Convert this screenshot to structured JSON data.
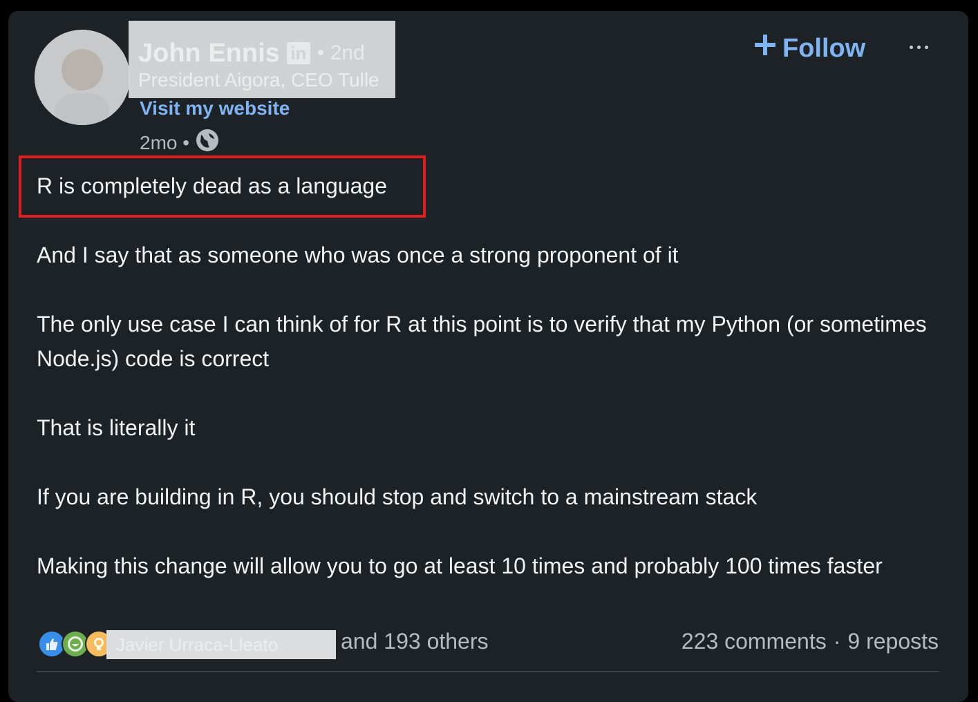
{
  "author": {
    "name": "John Ennis",
    "linkedin_badge": "in",
    "degree": "• 2nd",
    "headline": "President Aigora, CEO Tulle",
    "website_link": "Visit my website",
    "posted": "2mo •"
  },
  "actions": {
    "follow_label": "Follow",
    "follow_icon": "plus-icon",
    "more_icon": "more-icon"
  },
  "post": {
    "highlighted_line": "R is completely dead as a language",
    "paragraphs": [
      "And I say that as someone who was once a strong proponent of it",
      "The only use case I can think of for R at this point is to verify that my Python (or sometimes Node.js) code is correct",
      "That is literally it",
      "If you are building in R, you should stop and switch to a mainstream stack",
      "Making this change will allow you to go at least 10 times and probably 100 times faster"
    ]
  },
  "social": {
    "reaction_icons": [
      "like-icon",
      "celebrate-icon",
      "insightful-icon"
    ],
    "reactor_name": "Javier Urraca-Lleato",
    "others": "and 193 others",
    "comments": "223 comments",
    "separator": "·",
    "reposts": "9 reposts"
  },
  "colors": {
    "card_bg": "#1d2226",
    "link": "#7fb3f2",
    "highlight_border": "#e21d1d",
    "text": "#f1f3f4",
    "muted": "#b6bbc0"
  }
}
